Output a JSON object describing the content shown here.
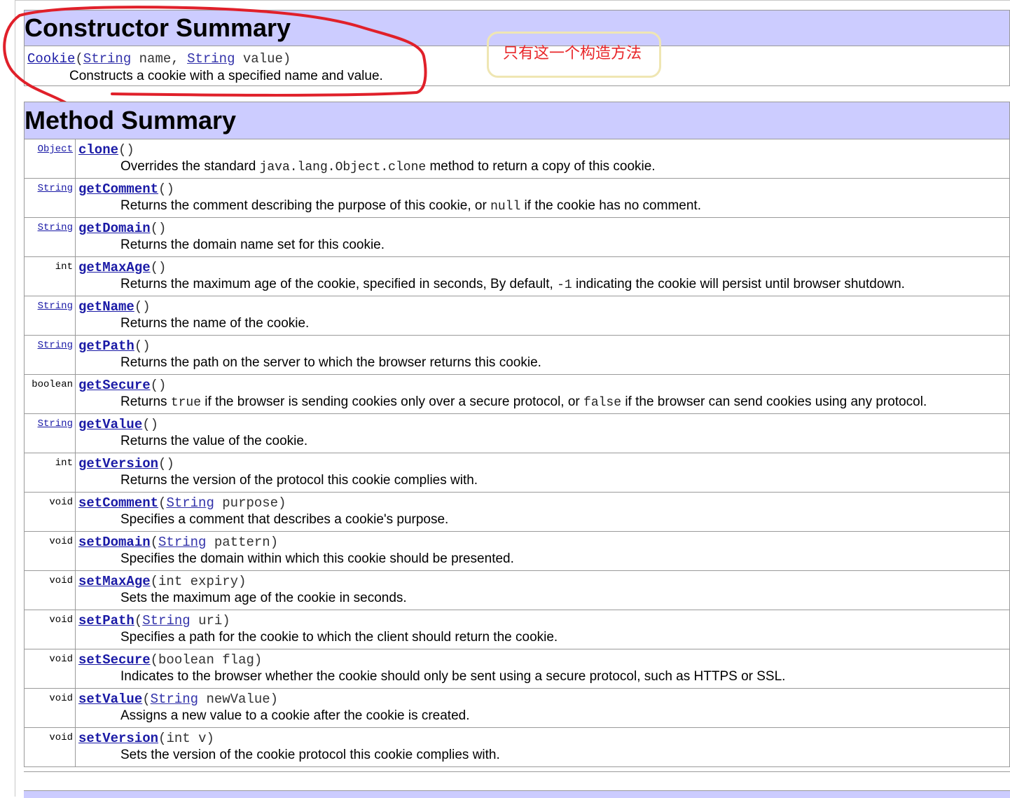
{
  "constructor_summary": {
    "heading": "Constructor Summary",
    "name": "Cookie",
    "open_paren": "(",
    "param1_type": "String",
    "param1_name": " name, ",
    "param2_type": "String",
    "param2_name": " value)",
    "description": "Constructs a cookie with a specified name and value."
  },
  "annotation": {
    "text": "只有这一个构造方法",
    "color": "#e8272b",
    "box_color": "#efe6b3"
  },
  "method_summary": {
    "heading": "Method Summary",
    "rows": [
      {
        "ret": "Object",
        "ret_link": true,
        "name": "clone",
        "params": [],
        "desc": [
          {
            "t": "Overrides the standard "
          },
          {
            "c": "java.lang.Object.clone"
          },
          {
            "t": " method to return a copy of this cookie."
          }
        ]
      },
      {
        "ret": "String",
        "ret_link": true,
        "name": "getComment",
        "params": [],
        "desc": [
          {
            "t": "Returns the comment describing the purpose of this cookie, or "
          },
          {
            "c": "null"
          },
          {
            "t": " if the cookie has no comment."
          }
        ]
      },
      {
        "ret": "String",
        "ret_link": true,
        "name": "getDomain",
        "params": [],
        "desc": [
          {
            "t": "Returns the domain name set for this cookie."
          }
        ]
      },
      {
        "ret": "int",
        "ret_link": false,
        "name": "getMaxAge",
        "params": [],
        "desc": [
          {
            "t": "Returns the maximum age of the cookie, specified in seconds, By default, "
          },
          {
            "c": "-1"
          },
          {
            "t": " indicating the cookie will persist until browser shutdown."
          }
        ]
      },
      {
        "ret": "String",
        "ret_link": true,
        "name": "getName",
        "params": [],
        "desc": [
          {
            "t": "Returns the name of the cookie."
          }
        ]
      },
      {
        "ret": "String",
        "ret_link": true,
        "name": "getPath",
        "params": [],
        "desc": [
          {
            "t": "Returns the path on the server to which the browser returns this cookie."
          }
        ]
      },
      {
        "ret": "boolean",
        "ret_link": false,
        "name": "getSecure",
        "params": [],
        "desc": [
          {
            "t": "Returns "
          },
          {
            "c": "true"
          },
          {
            "t": " if the browser is sending cookies only over a secure protocol, or "
          },
          {
            "c": "false"
          },
          {
            "t": " if the browser can send cookies using any protocol."
          }
        ]
      },
      {
        "ret": "String",
        "ret_link": true,
        "name": "getValue",
        "params": [],
        "desc": [
          {
            "t": "Returns the value of the cookie."
          }
        ]
      },
      {
        "ret": "int",
        "ret_link": false,
        "name": "getVersion",
        "params": [],
        "desc": [
          {
            "t": "Returns the version of the protocol this cookie complies with."
          }
        ]
      },
      {
        "ret": "void",
        "ret_link": false,
        "name": "setComment",
        "params": [
          {
            "type": "String",
            "link": true,
            "name": "purpose"
          }
        ],
        "desc": [
          {
            "t": "Specifies a comment that describes a cookie's purpose."
          }
        ]
      },
      {
        "ret": "void",
        "ret_link": false,
        "name": "setDomain",
        "params": [
          {
            "type": "String",
            "link": true,
            "name": "pattern"
          }
        ],
        "desc": [
          {
            "t": "Specifies the domain within which this cookie should be presented."
          }
        ]
      },
      {
        "ret": "void",
        "ret_link": false,
        "name": "setMaxAge",
        "params": [
          {
            "type": "int",
            "link": false,
            "name": "expiry"
          }
        ],
        "desc": [
          {
            "t": "Sets the maximum age of the cookie in seconds."
          }
        ]
      },
      {
        "ret": "void",
        "ret_link": false,
        "name": "setPath",
        "params": [
          {
            "type": "String",
            "link": true,
            "name": "uri"
          }
        ],
        "desc": [
          {
            "t": "Specifies a path for the cookie to which the client should return the cookie."
          }
        ]
      },
      {
        "ret": "void",
        "ret_link": false,
        "name": "setSecure",
        "params": [
          {
            "type": "boolean",
            "link": false,
            "name": "flag"
          }
        ],
        "desc": [
          {
            "t": "Indicates to the browser whether the cookie should only be sent using a secure protocol, such as HTTPS or SSL."
          }
        ]
      },
      {
        "ret": "void",
        "ret_link": false,
        "name": "setValue",
        "params": [
          {
            "type": "String",
            "link": true,
            "name": "newValue"
          }
        ],
        "desc": [
          {
            "t": "Assigns a new value to a cookie after the cookie is created."
          }
        ]
      },
      {
        "ret": "void",
        "ret_link": false,
        "name": "setVersion",
        "params": [
          {
            "type": "int",
            "link": false,
            "name": "v"
          }
        ],
        "desc": [
          {
            "t": "Sets the version of the cookie protocol this cookie complies with."
          }
        ]
      }
    ]
  },
  "colors": {
    "header_bg": "#ccccff",
    "link": "#1a1aa6",
    "border": "#9a9a9a",
    "highlight_loop": "#e0202a"
  }
}
